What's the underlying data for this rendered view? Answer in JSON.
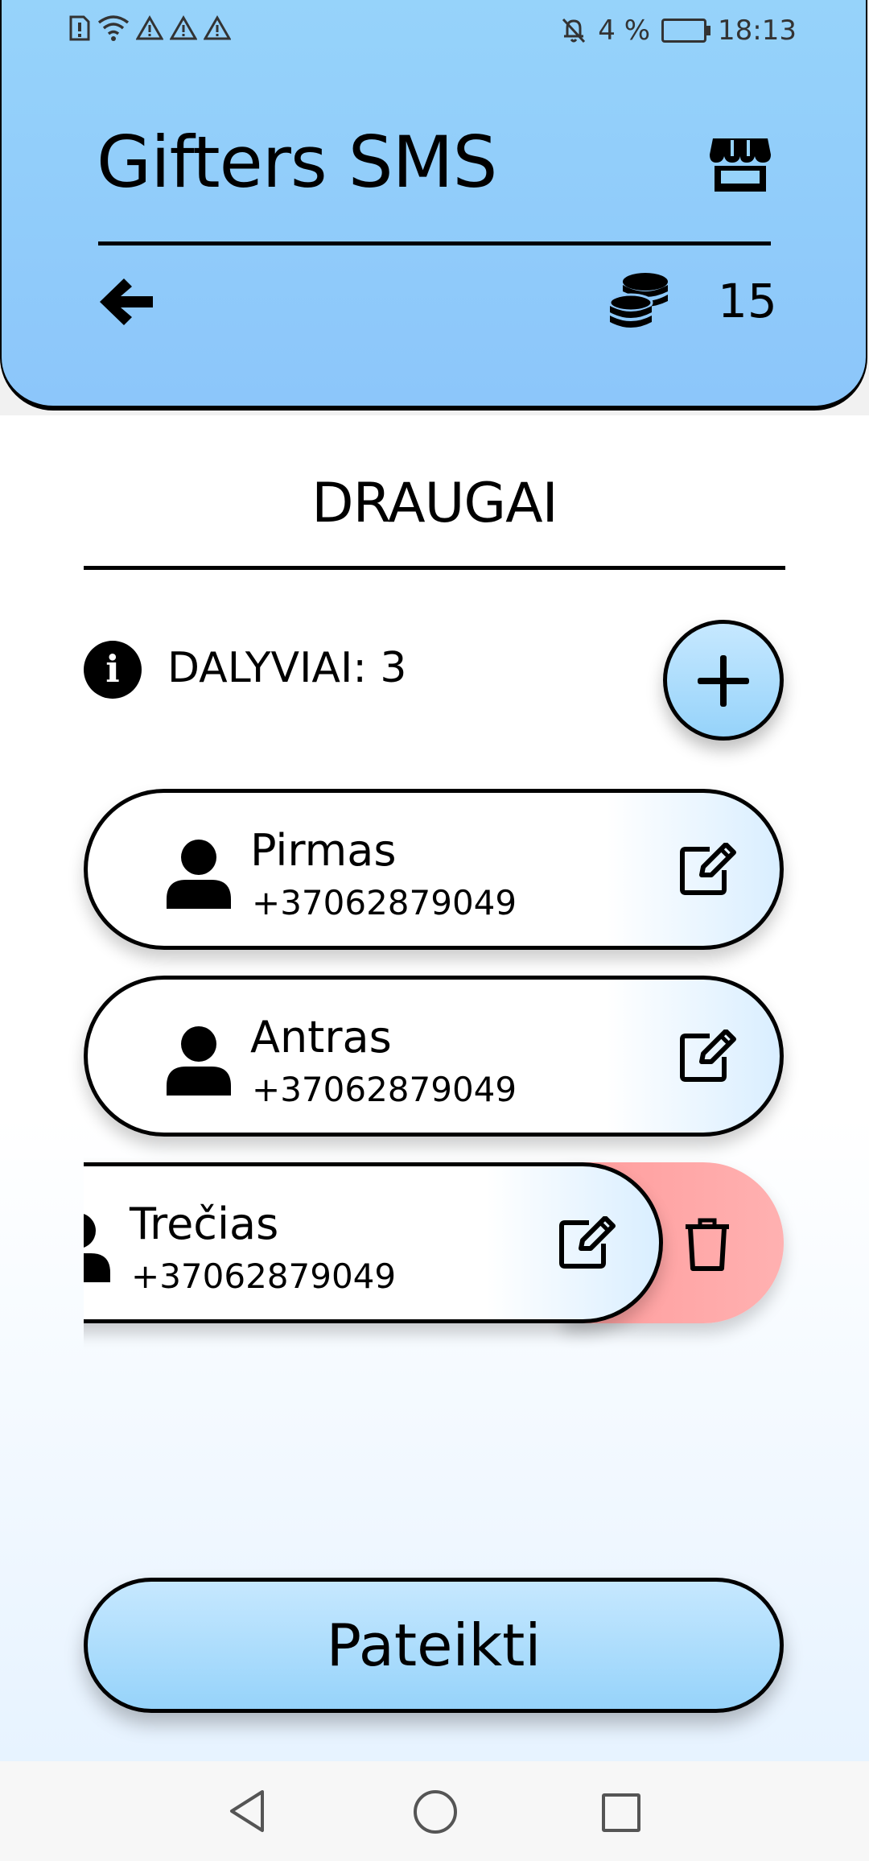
{
  "status_bar": {
    "battery_text": "4 %",
    "time": "18:13",
    "left_icons": [
      "sim-alert-icon",
      "wifi-icon",
      "warning-icon",
      "warning-icon",
      "warning-icon"
    ],
    "right_icons": [
      "bell-off-icon",
      "battery-charging-icon"
    ]
  },
  "header": {
    "title": "Gifters SMS",
    "coins": "15",
    "icons": {
      "shop": "shop-icon",
      "back": "arrow-left-icon",
      "coins": "coins-icon"
    }
  },
  "section": {
    "title": "DRAUGAI",
    "participants_label": "DALYVIAI: 3"
  },
  "friends": [
    {
      "name": "Pirmas",
      "phone": "+37062879049"
    },
    {
      "name": "Antras",
      "phone": "+37062879049"
    },
    {
      "name": "Trečias",
      "phone": "+37062879049"
    }
  ],
  "submit_label": "Pateikti",
  "colors": {
    "header_bg": "#96d3fa",
    "button_bg": "#96d3fa",
    "delete_bg": "#ffa3a3",
    "text": "#000000"
  }
}
